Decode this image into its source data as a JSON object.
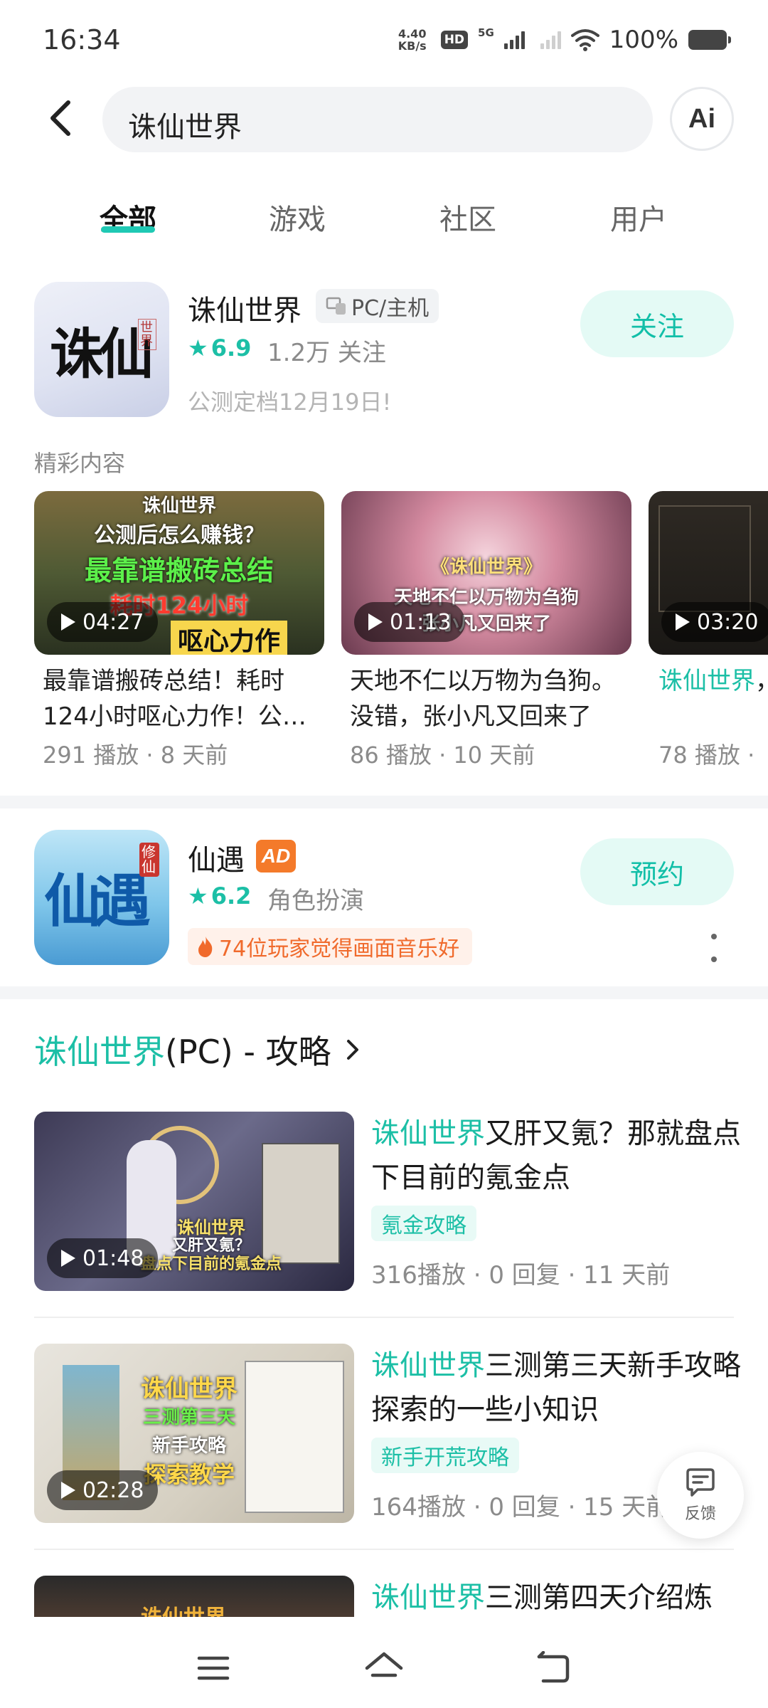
{
  "status_bar": {
    "time": "16:34",
    "net_speed_value": "4.40",
    "net_speed_unit": "KB/s",
    "hd_label": "HD",
    "network_label": "5G",
    "battery": "100%"
  },
  "search": {
    "query": "诛仙世界",
    "ai_label": "Ai"
  },
  "tabs": [
    {
      "label": "全部",
      "active": true
    },
    {
      "label": "游戏",
      "active": false
    },
    {
      "label": "社区",
      "active": false
    },
    {
      "label": "用户",
      "active": false
    }
  ],
  "game_result": {
    "title": "诛仙世界",
    "platform": "PC/主机",
    "rating": "6.9",
    "followers": "1.2万 关注",
    "note": "公测定档12月19日!",
    "follow_label": "关注",
    "icon_text": "诛仙",
    "icon_seal": "世界"
  },
  "featured": {
    "label": "精彩内容",
    "videos": [
      {
        "thumb_lines": [
          "诛仙世界",
          "公测后怎么赚钱？",
          "最靠谱搬砖总结",
          "耗时124小时",
          "呕心力作"
        ],
        "duration": "04:27",
        "caption": "最靠谱搬砖总结！耗时124小时呕心力作！公…",
        "stats": "291 播放 · 8 天前"
      },
      {
        "thumb_lines": [
          "《诛仙世界》",
          "天地不仁以万物为刍狗",
          "张小凡又回来了"
        ],
        "duration": "01:13",
        "caption": "天地不仁以万物为刍狗。没错，张小凡又回来了",
        "stats": "86 播放 · 10 天前"
      },
      {
        "thumb_lines": [],
        "duration": "03:20",
        "caption_highlight": "诛仙世界",
        "caption_rest": "，讲解分析",
        "stats": "78 播放 ·"
      }
    ]
  },
  "ad_result": {
    "title": "仙遇",
    "ad_label": "AD",
    "rating": "6.2",
    "genre": "角色扮演",
    "hot_tag": "74位玩家觉得画面音乐好",
    "button_label": "预约",
    "icon_text": "仙遇",
    "icon_seal": "修仙"
  },
  "guides": {
    "header_highlight": "诛仙世界",
    "header_rest": "(PC) - 攻略",
    "items": [
      {
        "title_highlight": "诛仙世界",
        "title_rest": "又肝又氪？那就盘点下目前的氪金点",
        "tag": "氪金攻略",
        "stats": "316播放 · 0 回复 · 11 天前",
        "duration": "01:48",
        "thumb_lines": [
          "诛仙世界",
          "又肝又氪？",
          "盘点下目前的氪金点"
        ]
      },
      {
        "title_highlight": "诛仙世界",
        "title_rest": "三测第三天新手攻略探索的一些小知识",
        "tag": "新手开荒攻略",
        "stats": "164播放 · 0 回复 · 15 天前",
        "duration": "02:28",
        "thumb_lines": [
          "诛仙世界",
          "三测第三天",
          "新手攻略",
          "探索教学"
        ]
      },
      {
        "title_highlight": "诛仙世界",
        "title_rest": "三测第四天介绍炼",
        "thumb_lines": [
          "诛仙世界"
        ]
      }
    ]
  },
  "feedback": {
    "label": "反馈"
  },
  "colors": {
    "accent": "#1cbfa6",
    "accent_bg": "#e4faf5",
    "ad_orange": "#f47a2a",
    "muted": "#8b8b8b"
  }
}
